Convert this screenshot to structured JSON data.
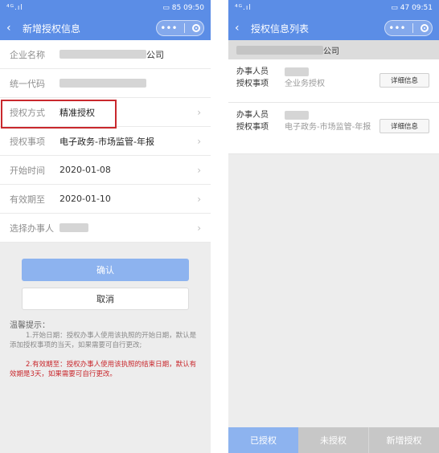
{
  "left": {
    "status": {
      "signal": "⁴ᴳ.ıl",
      "battery": "85",
      "time": "09:50"
    },
    "title": "新增授权信息",
    "fields": [
      {
        "label": "企业名称",
        "value": "公司"
      },
      {
        "label": "统一代码",
        "value": ""
      },
      {
        "label": "授权方式",
        "value": "精准授权"
      },
      {
        "label": "授权事项",
        "value": "电子政务-市场监管-年报"
      },
      {
        "label": "开始时间",
        "value": "2020-01-08"
      },
      {
        "label": "有效期至",
        "value": "2020-01-10"
      },
      {
        "label": "选择办事人",
        "value": ""
      }
    ],
    "confirm_label": "确认",
    "cancel_label": "取消",
    "tips_title": "温馨提示：",
    "tip1": "1.开始日期：授权办事人使用该执照的开始日期，默认是添加授权事项的当天，如果需要可自行更改;",
    "tip2": "2.有效期至：授权办事人使用该执照的结束日期，默认有效期是3天，如果需要可自行更改。"
  },
  "right": {
    "status": {
      "signal": "⁴ᴳ.ıl",
      "battery": "47",
      "time": "09:51"
    },
    "title": "授权信息列表",
    "company": "公司",
    "cards": [
      {
        "person_label": "办事人员",
        "scope_label": "授权事项",
        "scope_value": "全业务授权",
        "detail_label": "详细信息"
      },
      {
        "person_label": "办事人员",
        "scope_label": "授权事项",
        "scope_value": "电子政务-市场监管-年报",
        "detail_label": "详细信息"
      }
    ],
    "tabs": [
      "已授权",
      "未授权",
      "新增授权"
    ]
  },
  "colors": {
    "header": "#5b8de6",
    "highlight": "#c9282d",
    "confirm": "#8db3ef"
  }
}
